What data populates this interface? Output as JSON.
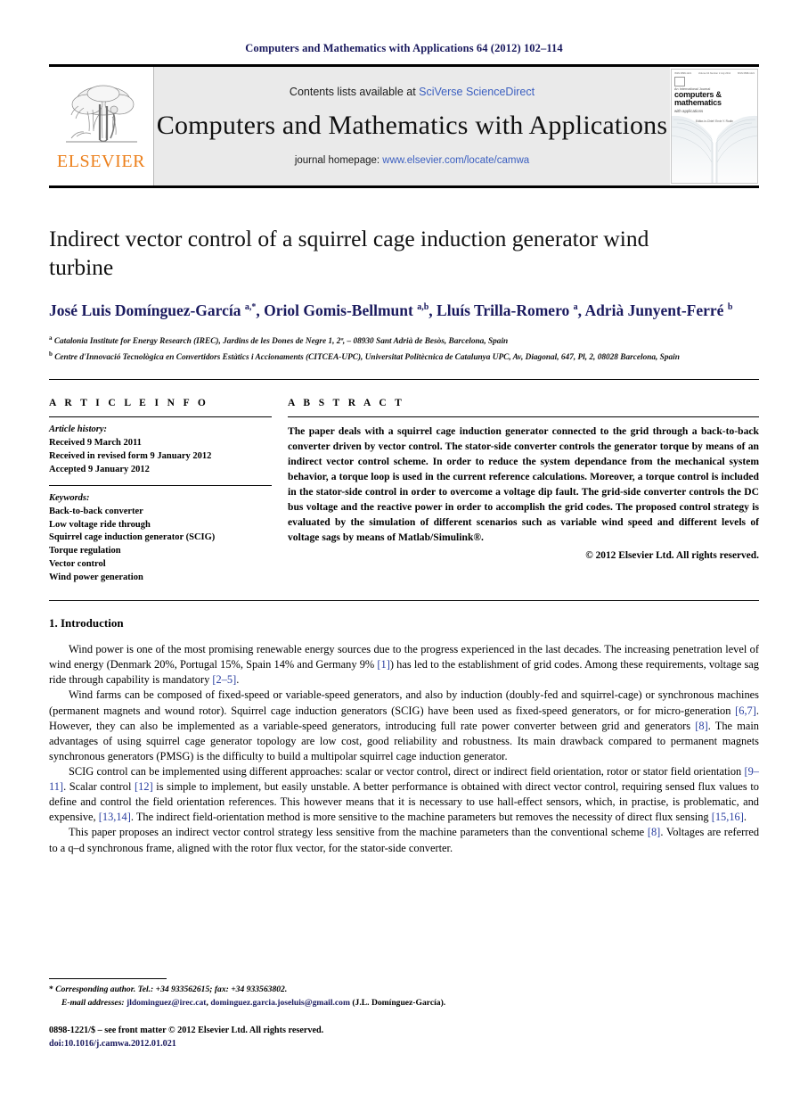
{
  "running_head": "Computers and Mathematics with Applications 64 (2012) 102–114",
  "masthead": {
    "contents_prefix": "Contents lists available at ",
    "sciencedirect": "SciVerse ScienceDirect",
    "journal_title": "Computers and Mathematics with Applications",
    "homepage_prefix": "journal homepage: ",
    "homepage_url": "www.elsevier.com/locate/camwa",
    "publisher_wordmark": "ELSEVIER",
    "publisher_logo_color": "#ec7f1a",
    "link_color": "#3b5fc0"
  },
  "cover": {
    "top_left": "ISSN 0898-1221",
    "top_center": "Volume 64   Number 2   July 2012",
    "top_right": "ISSN 0898-1221",
    "kicker": "An International Journal",
    "title_line1": "computers &",
    "title_line2": "mathematics",
    "subtitle": "with applications",
    "editor": "Editor-in-Chief:  Ervin Y. Rodin"
  },
  "article": {
    "title": "Indirect vector control of a squirrel cage induction generator wind turbine",
    "authors_html": "José Luis Domínguez-García <sup>a,*</sup>, Oriol Gomis-Bellmunt <sup>a,b</sup>, Lluís Trilla-Romero <sup>a</sup>, Adrià Junyent-Ferré <sup>b</sup>",
    "affiliation_a": "Catalonia Institute for Energy Research (IREC), Jardins de les Dones de Negre 1, 2ª, – 08930 Sant Adrià de Besòs, Barcelona, Spain",
    "affiliation_b": "Centre d'Innovació Tecnològica en Convertidors Estàtics i Accionaments (CITCEA-UPC), Universitat Politècnica de Catalunya UPC, Av, Diagonal, 647, Pl, 2, 08028 Barcelona, Spain"
  },
  "article_info": {
    "heading": "A R T I C L E    I N F O",
    "history_label": "Article history:",
    "history": [
      "Received 9 March 2011",
      "Received in revised form 9 January 2012",
      "Accepted 9 January 2012"
    ],
    "keywords_label": "Keywords:",
    "keywords": [
      "Back-to-back converter",
      "Low voltage ride through",
      "Squirrel cage induction generator (SCIG)",
      "Torque regulation",
      "Vector control",
      "Wind power generation"
    ]
  },
  "abstract": {
    "heading": "A B S T R A C T",
    "text": "The paper deals with a squirrel cage induction generator connected to the grid through a back-to-back converter driven by vector control. The stator-side converter controls the generator torque by means of an indirect vector control scheme. In order to reduce the system dependance from the mechanical system behavior, a torque loop is used in the current reference calculations. Moreover, a torque control is included in the stator-side control in order to overcome a voltage dip fault. The grid-side converter controls the DC bus voltage and the reactive power in order to accomplish the grid codes. The proposed control strategy is evaluated by the simulation of different scenarios such as variable wind speed and different levels of voltage sags by means of Matlab/Simulink®.",
    "copyright": "© 2012 Elsevier Ltd. All rights reserved."
  },
  "body": {
    "section_heading": "1.  Introduction",
    "paragraphs": [
      "Wind power is one of the most promising renewable energy sources due to the progress experienced in the last decades. The increasing penetration level of wind energy (Denmark 20%, Portugal 15%, Spain 14% and Germany 9% [1]) has led to the establishment of grid codes. Among these requirements, voltage sag ride through capability is mandatory [2–5].",
      "Wind farms can be composed of fixed-speed or variable-speed generators, and also by induction (doubly-fed and squirrel-cage) or synchronous machines (permanent magnets and wound rotor). Squirrel cage induction generators (SCIG) have been used as fixed-speed generators, or for micro-generation [6,7]. However, they can also be implemented as a variable-speed generators, introducing full rate power converter between grid and generators [8]. The main advantages of using squirrel cage generator topology are low cost, good reliability and robustness. Its main drawback compared to permanent magnets synchronous generators (PMSG) is the difficulty to build a multipolar squirrel cage induction generator.",
      "SCIG control can be implemented using different approaches: scalar or vector control, direct or indirect field orientation, rotor or stator field orientation [9–11]. Scalar control [12] is simple to implement, but easily unstable. A better performance is obtained with direct vector control, requiring sensed flux values to define and control the field orientation references. This however means that it is necessary to use hall-effect sensors, which, in practise, is problematic, and expensive, [13,14]. The indirect field-orientation method is more sensitive to the machine parameters but removes the necessity of direct flux sensing [15,16].",
      "This paper proposes an indirect vector control strategy less sensitive from the machine parameters than the conventional scheme [8]. Voltages are referred to a q–d synchronous frame, aligned with the rotor flux vector, for the stator-side converter."
    ],
    "citation_color": "#2a3fa0"
  },
  "footnotes": {
    "corresponding_marker": "*",
    "corresponding_text": "Corresponding author. Tel.: +34 933562615; fax: +34 933563802.",
    "email_label": "E-mail addresses:",
    "email_1": "jldominguez@irec.cat",
    "email_2": "dominguez.garcia.joseluis@gmail.com",
    "email_attrib": "(J.L. Domínguez-García).",
    "issn_line": "0898-1221/$ – see front matter © 2012 Elsevier Ltd. All rights reserved.",
    "doi": "doi:10.1016/j.camwa.2012.01.021"
  }
}
